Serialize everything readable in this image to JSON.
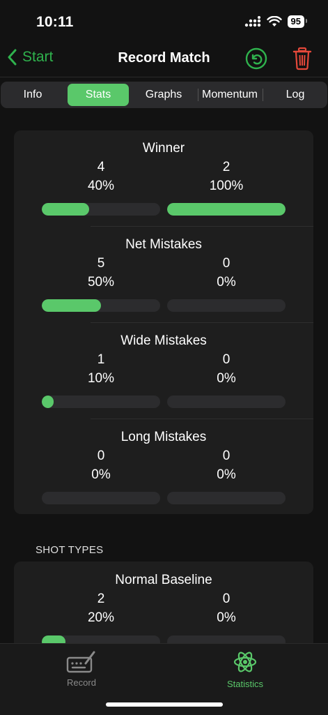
{
  "status": {
    "time": "10:11",
    "battery": "95"
  },
  "nav": {
    "back_label": "Start",
    "title": "Record Match"
  },
  "colors": {
    "accent": "#5ac86a",
    "back_green": "#2fb24d",
    "delete_red": "#e5483a",
    "background": "#121212",
    "card": "#1e1e1e"
  },
  "tabs": [
    {
      "label": "Info"
    },
    {
      "label": "Stats"
    },
    {
      "label": "Graphs"
    },
    {
      "label": "Momentum"
    },
    {
      "label": "Log"
    }
  ],
  "active_tab": "Stats",
  "stats": [
    {
      "title": "Winner",
      "left": {
        "count": "4",
        "pct": "40%",
        "fraction": 0.4
      },
      "right": {
        "count": "2",
        "pct": "100%",
        "fraction": 1.0
      }
    },
    {
      "title": "Net Mistakes",
      "left": {
        "count": "5",
        "pct": "50%",
        "fraction": 0.5
      },
      "right": {
        "count": "0",
        "pct": "0%",
        "fraction": 0
      }
    },
    {
      "title": "Wide Mistakes",
      "left": {
        "count": "1",
        "pct": "10%",
        "fraction": 0.1
      },
      "right": {
        "count": "0",
        "pct": "0%",
        "fraction": 0
      }
    },
    {
      "title": "Long Mistakes",
      "left": {
        "count": "0",
        "pct": "0%",
        "fraction": 0
      },
      "right": {
        "count": "0",
        "pct": "0%",
        "fraction": 0
      }
    }
  ],
  "shot_types": {
    "header": "SHOT TYPES",
    "items": [
      {
        "title": "Normal Baseline",
        "left": {
          "count": "2",
          "pct": "20%",
          "fraction": 0.2
        },
        "right": {
          "count": "0",
          "pct": "0%",
          "fraction": 0
        }
      }
    ]
  },
  "tab_bar": {
    "items": [
      {
        "label": "Record",
        "icon": "keyboard-pen-icon"
      },
      {
        "label": "Statistics",
        "icon": "atom-icon"
      }
    ]
  }
}
